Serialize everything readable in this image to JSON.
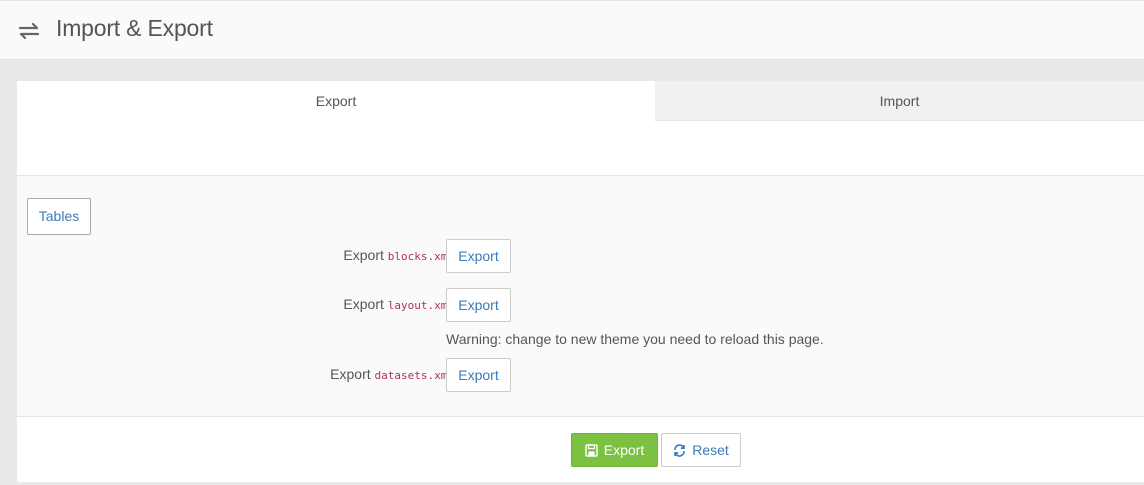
{
  "header": {
    "title": "Import & Export",
    "icon": "exchange-icon"
  },
  "tabs": [
    {
      "label": "Export",
      "active": true
    },
    {
      "label": "Import",
      "active": false
    }
  ],
  "tables_button": "Tables",
  "rows": [
    {
      "prefix": "Export",
      "file": "blocks.xml",
      "button": "Export"
    },
    {
      "prefix": "Export",
      "file": "layout.xml",
      "button": "Export"
    },
    {
      "prefix": "Export",
      "file": "datasets.xml",
      "button": "Export"
    }
  ],
  "warning": "Warning: change to new theme you need to reload this page.",
  "footer": {
    "export_label": "Export",
    "reset_label": "Reset"
  },
  "colors": {
    "primary_green": "#7dc142",
    "link_blue": "#3a7bb8",
    "code_red": "#b0324f"
  }
}
